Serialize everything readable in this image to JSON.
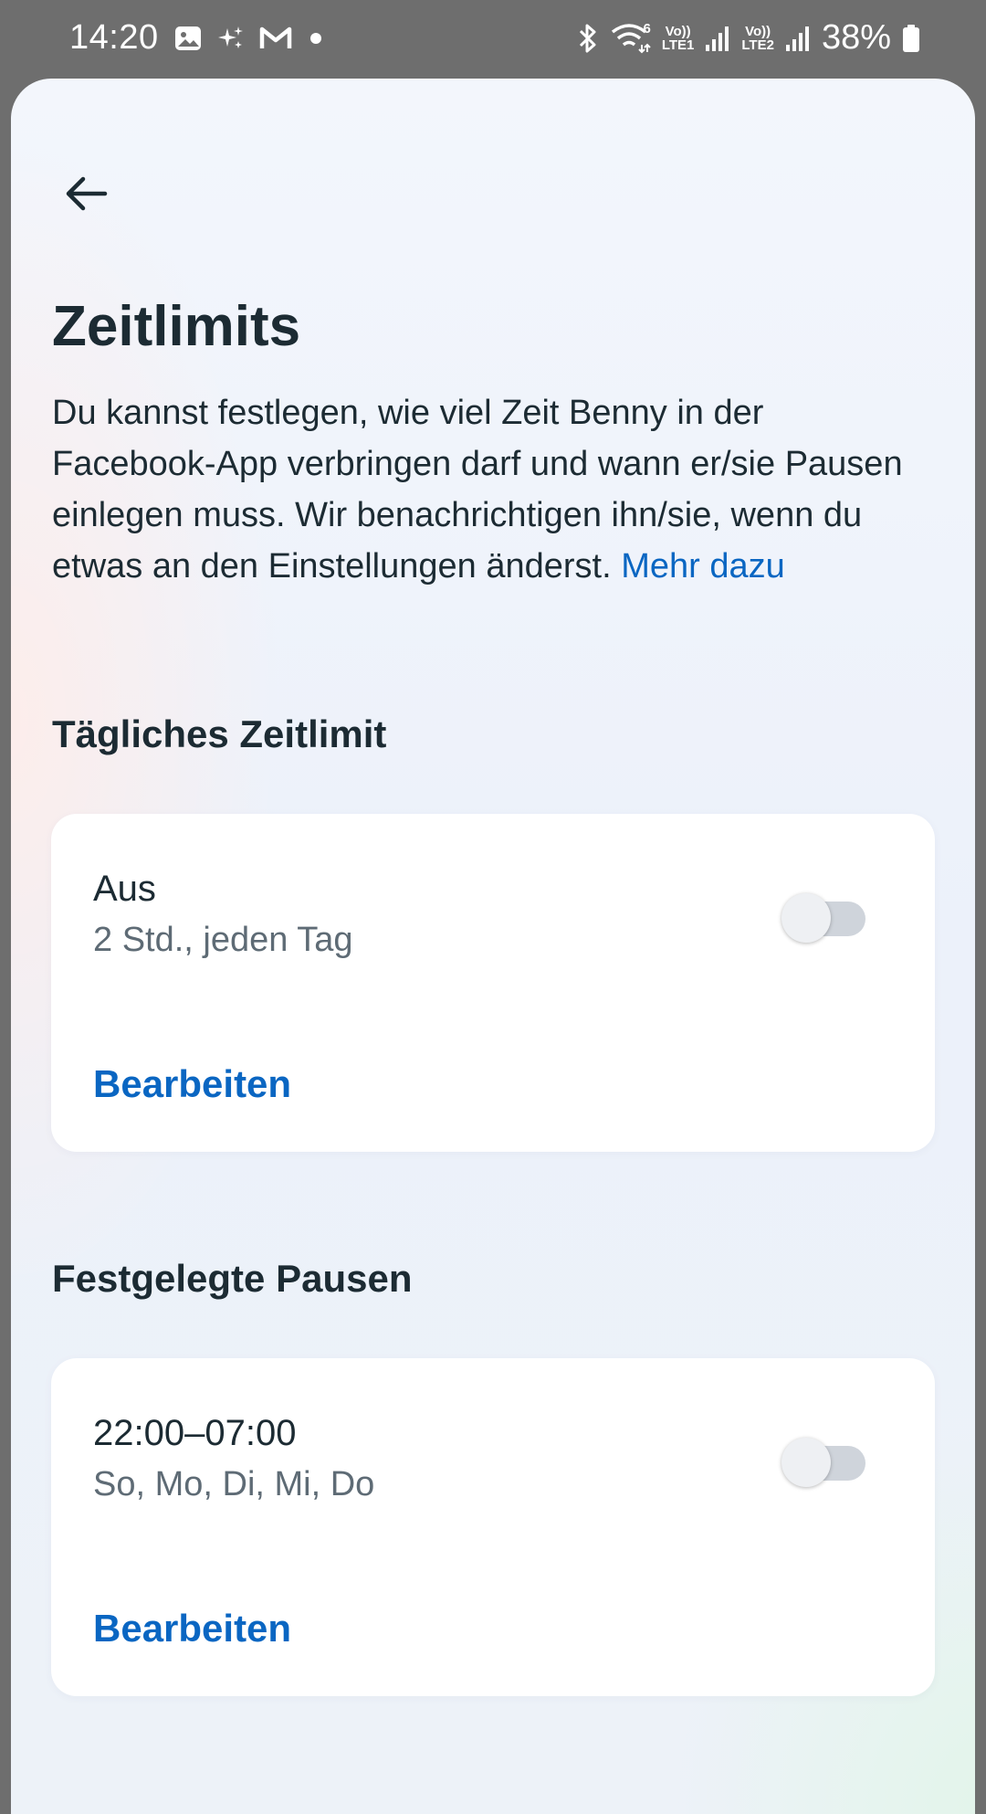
{
  "status_bar": {
    "time": "14:20",
    "battery": "38%",
    "sim1_label_top": "Vo))",
    "sim1_label_bottom": "LTE1",
    "sim2_label_top": "Vo))",
    "sim2_label_bottom": "LTE2",
    "wifi_badge": "6",
    "icons": [
      "gallery-icon",
      "sparkle-icon",
      "gmail-icon",
      "dot-icon",
      "bluetooth-icon",
      "wifi-icon",
      "signal-icon",
      "battery-icon"
    ]
  },
  "page": {
    "back_icon": "arrow-left-icon",
    "title": "Zeitlimits",
    "description": "Du kannst festlegen, wie viel Zeit Benny in der Facebook-App verbringen darf und wann er/sie Pausen einlegen muss. Wir benachrichtigen ihn/sie, wenn du etwas an den Einstellungen änderst.",
    "description_link": "Mehr dazu"
  },
  "daily_limit": {
    "heading": "Tägliches Zeitlimit",
    "status": "Aus",
    "detail": "2 Std., jeden Tag",
    "toggle_on": false,
    "edit_label": "Bearbeiten"
  },
  "scheduled_breaks": {
    "heading": "Festgelegte Pausen",
    "time_range": "22:00–07:00",
    "days": "So, Mo, Di, Mi, Do",
    "toggle_on": false,
    "edit_label": "Bearbeiten"
  },
  "colors": {
    "link": "#0a66c2",
    "text_primary": "#1c2b33",
    "text_secondary": "#5e6b75",
    "toggle_off_track": "#cfd4db"
  }
}
